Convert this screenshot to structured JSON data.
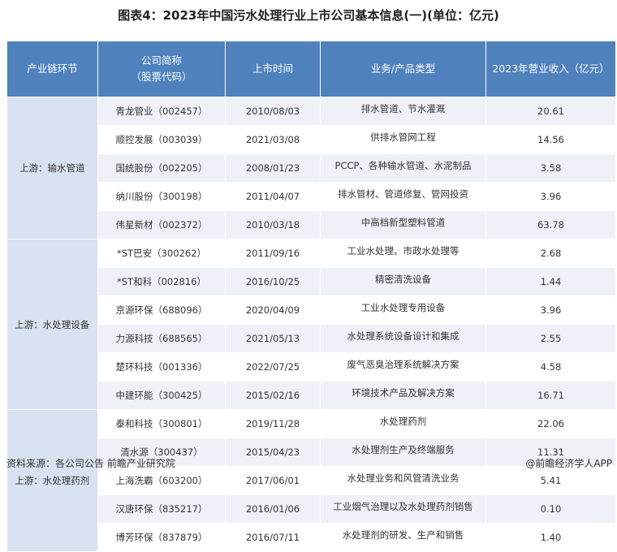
{
  "title": "图表4：2023年中国污水处理行业上市公司基本信息(一)(单位：亿元)",
  "headers": {
    "chain": "产业链环节",
    "company_line1": "公司简称",
    "company_line2": "（股票代码）",
    "date": "上市时间",
    "business": "业务/产品类型",
    "revenue": "2023年营业收入（亿元）"
  },
  "segments": [
    {
      "name": "上游：输水管道",
      "rows": [
        {
          "company": "青龙管业（002457）",
          "date": "2010/08/03",
          "business": "排水管道、节水灌溉",
          "revenue": "20.61"
        },
        {
          "company": "顺控发展（003039）",
          "date": "2021/03/08",
          "business": "供排水管网工程",
          "revenue": "14.56"
        },
        {
          "company": "国统股份（002205）",
          "date": "2008/01/23",
          "business": "PCCP、各种输水管道、水泥制品",
          "revenue": "3.58"
        },
        {
          "company": "纳川股份（300198）",
          "date": "2011/04/07",
          "business": "排水管材、管道修复、管网投资",
          "revenue": "3.96"
        },
        {
          "company": "伟星新材（002372）",
          "date": "2010/03/18",
          "business": "中高档新型塑料管道",
          "revenue": "63.78"
        }
      ]
    },
    {
      "name": "上游：水处理设备",
      "rows": [
        {
          "company": "*ST巴安（300262）",
          "date": "2011/09/16",
          "business": "工业水处理、市政水处理等",
          "revenue": "2.68"
        },
        {
          "company": "*ST和科（002816）",
          "date": "2016/10/25",
          "business": "精密清洗设备",
          "revenue": "1.44"
        },
        {
          "company": "京源环保（688096）",
          "date": "2020/04/09",
          "business": "工业水处理专用设备",
          "revenue": "3.96"
        },
        {
          "company": "力源科技（688565）",
          "date": "2021/05/13",
          "business": "水处理系统设备设计和集成",
          "revenue": "2.55"
        },
        {
          "company": "楚环科技（001336）",
          "date": "2022/07/25",
          "business": "废气恶臭治理系统解决方案",
          "revenue": "4.58"
        },
        {
          "company": "中建环能（300425）",
          "date": "2015/02/16",
          "business": "环境技术产品及解决方案",
          "revenue": "16.71"
        }
      ]
    },
    {
      "name": "上游：水处理药剂",
      "rows": [
        {
          "company": "泰和科技（300801）",
          "date": "2019/11/28",
          "business": "水处理药剂",
          "revenue": "22.06"
        },
        {
          "company": "清水源（300437）",
          "date": "2015/04/23",
          "business": "水处理剂生产及终端服务",
          "revenue": "11.31"
        },
        {
          "company": "上海洗霸（603200）",
          "date": "2017/06/01",
          "business": "水处理业务和风管清洗业务",
          "revenue": "5.41"
        },
        {
          "company": "汉唐环保（835217）",
          "date": "2016/01/06",
          "business": "工业烟气治理以及水处理药剂销售",
          "revenue": "0.10"
        },
        {
          "company": "博芳环保（837879）",
          "date": "2016/07/11",
          "business": "水处理剂的研发、生产和销售",
          "revenue": "1.40"
        }
      ]
    }
  ],
  "footer": {
    "source": "资料来源：各公司公告 前瞻产业研究院",
    "brand": "@前瞻经济学人APP"
  }
}
